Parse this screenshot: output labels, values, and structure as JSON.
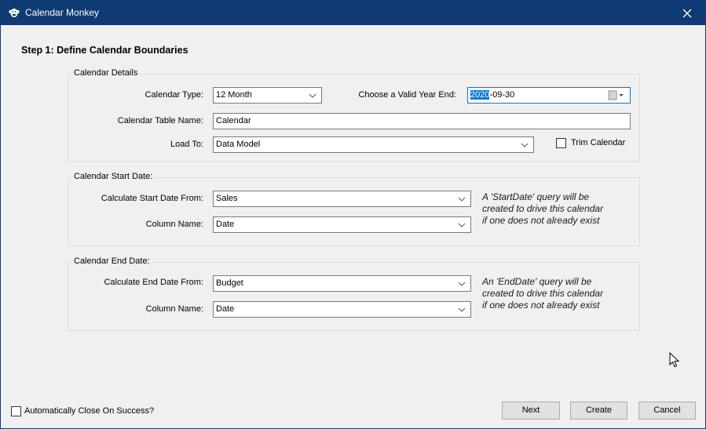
{
  "window": {
    "title": "Calendar Monkey",
    "app_icon": "monkey-icon",
    "close_icon": "close-icon"
  },
  "step_title": "Step 1:  Define Calendar Boundaries",
  "calendar_details": {
    "legend": "Calendar Details",
    "calendar_type_label": "Calendar Type:",
    "calendar_type_value": "12 Month",
    "year_end_label": "Choose a Valid Year End:",
    "year_end_value_selected": "2020",
    "year_end_value_rest": "-09-30",
    "table_name_label": "Calendar Table Name:",
    "table_name_value": "Calendar",
    "load_to_label": "Load To:",
    "load_to_value": "Data Model",
    "trim_calendar_label": "Trim Calendar",
    "trim_calendar_checked": false
  },
  "start_date": {
    "legend": "Calendar Start Date:",
    "calc_from_label": "Calculate Start Date From:",
    "calc_from_value": "Sales",
    "column_label": "Column Name:",
    "column_value": "Date",
    "note_lines": [
      "A 'StartDate' query will be",
      "created to drive this calendar",
      "if one does not already exist"
    ]
  },
  "end_date": {
    "legend": "Calendar End Date:",
    "calc_from_label": "Calculate End Date From:",
    "calc_from_value": "Budget",
    "column_label": "Column Name:",
    "column_value": "Date",
    "note_lines": [
      "An 'EndDate' query will be",
      "created to drive this calendar",
      "if one does not already exist"
    ]
  },
  "footer": {
    "auto_close_label": "Automatically Close On Success?",
    "auto_close_checked": false,
    "buttons": {
      "next": "Next",
      "create": "Create",
      "cancel": "Cancel"
    }
  },
  "colors": {
    "titlebar": "#0f3a73",
    "selection": "#0078d7",
    "background": "#f0f0f0"
  }
}
